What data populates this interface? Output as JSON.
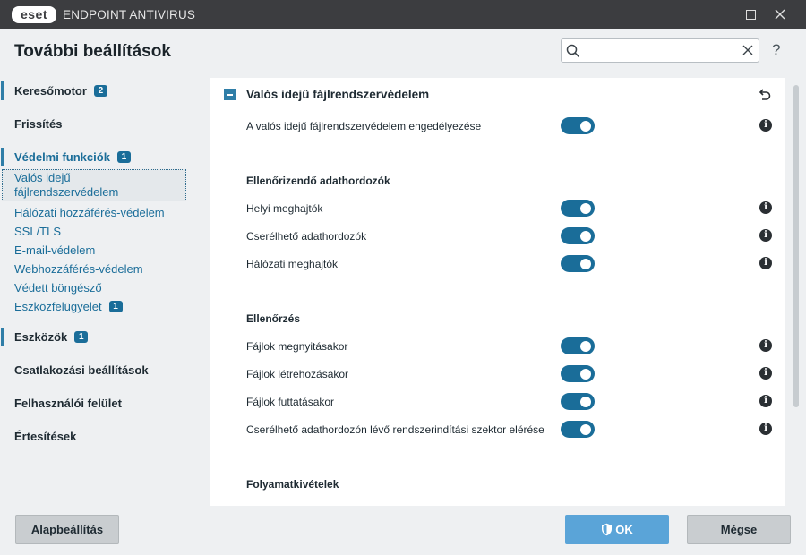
{
  "titlebar": {
    "logo_text": "eset",
    "product_name": "ENDPOINT ANTIVIRUS"
  },
  "header": {
    "title": "További beállítások",
    "search_value": "",
    "help_label": "?"
  },
  "sidebar": {
    "items": [
      {
        "label": "Keresőmotor",
        "badge": "2"
      },
      {
        "label": "Frissítés"
      },
      {
        "label": "Védelmi funkciók",
        "badge": "1"
      },
      {
        "label": "Valós idejű fájlrendszervédelem"
      },
      {
        "label": "Hálózati hozzáférés-védelem"
      },
      {
        "label": "SSL/TLS"
      },
      {
        "label": "E-mail-védelem"
      },
      {
        "label": "Webhozzáférés-védelem"
      },
      {
        "label": "Védett böngésző"
      },
      {
        "label": "Eszközfelügyelet",
        "badge": "1"
      },
      {
        "label": "Eszközök",
        "badge": "1"
      },
      {
        "label": "Csatlakozási beállítások"
      },
      {
        "label": "Felhasználói felület"
      },
      {
        "label": "Értesítések"
      }
    ]
  },
  "main": {
    "section_title": "Valós idejű fájlrendszervédelem",
    "enable_label": "A valós idejű fájlrendszervédelem engedélyezése",
    "enable_on": true,
    "groups": [
      {
        "title": "Ellenőrizendő adathordozók",
        "rows": [
          {
            "label": "Helyi meghajtók",
            "on": true
          },
          {
            "label": "Cserélhető adathordozók",
            "on": true
          },
          {
            "label": "Hálózati meghajtók",
            "on": true
          }
        ]
      },
      {
        "title": "Ellenőrzés",
        "rows": [
          {
            "label": "Fájlok megnyitásakor",
            "on": true
          },
          {
            "label": "Fájlok létrehozásakor",
            "on": true
          },
          {
            "label": "Fájlok futtatásakor",
            "on": true
          },
          {
            "label": "Cserélhető adathordozón lévő rendszerindítási szektor elérése",
            "on": true
          }
        ]
      },
      {
        "title": "Folyamatkivételek",
        "rows": []
      }
    ],
    "info_glyph": "i"
  },
  "footer": {
    "default_label": "Alapbeállítás",
    "ok_label": "OK",
    "cancel_label": "Mégse"
  },
  "colors": {
    "accent": "#1a6d99",
    "titlebar": "#3c3d40",
    "ok_button": "#5aa4d8"
  }
}
